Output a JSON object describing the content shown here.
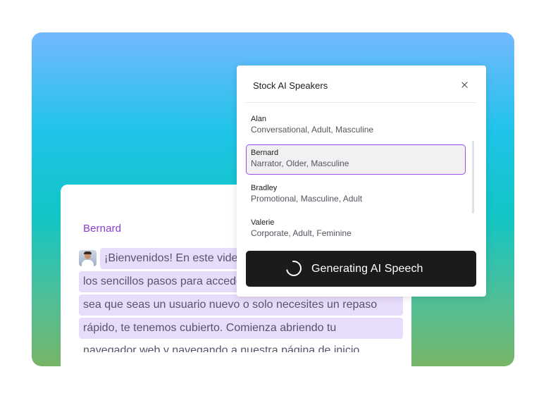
{
  "transcript": {
    "speaker": "Bernard",
    "lines": [
      "¡Bienvenidos! En este video",
      "los sencillos pasos para acceder",
      "sea que seas un usuario nuevo o solo necesites un repaso",
      "rápido, te tenemos cubierto. Comienza abriendo tu",
      "navegador web y navegando a nuestra página de inicio"
    ]
  },
  "dialog": {
    "title": "Stock AI Speakers",
    "close_icon": "close-icon",
    "voices": [
      {
        "name": "Alan",
        "tags": "Conversational, Adult, Masculine",
        "selected": false
      },
      {
        "name": "Bernard",
        "tags": "Narrator, Older, Masculine",
        "selected": true
      },
      {
        "name": "Bradley",
        "tags": "Promotional, Masculine, Adult",
        "selected": false
      },
      {
        "name": "Valerie",
        "tags": "Corporate, Adult, Feminine",
        "selected": false
      }
    ],
    "generate_label": "Generating AI Speech",
    "spinner_icon": "spinner-icon"
  },
  "colors": {
    "accent": "#9a4fe0",
    "speaker_text": "#8a3dd1",
    "highlight": "#e8dcfb",
    "button_bg": "#1b1b1b"
  }
}
